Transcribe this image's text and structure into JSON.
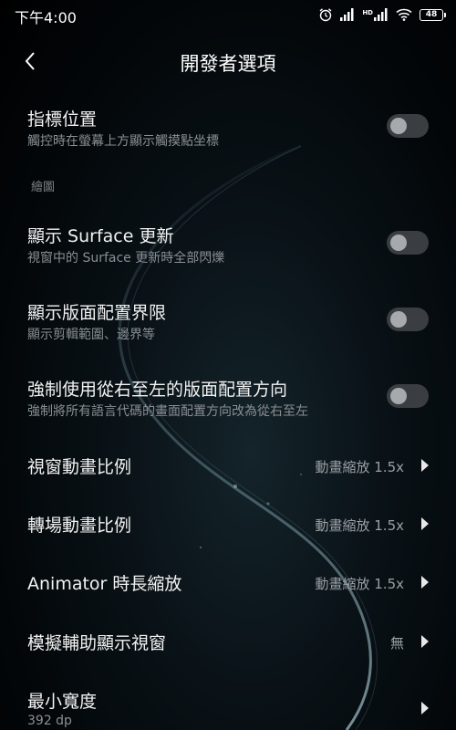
{
  "status_bar": {
    "time": "下午4:00",
    "hd_label": "HD",
    "battery_level": "48",
    "icons": [
      "alarm-icon",
      "signal-icon",
      "hd-signal-icon",
      "wifi-icon",
      "battery-icon"
    ]
  },
  "header": {
    "title": "開發者選項",
    "back_icon": "chevron-left-icon"
  },
  "settings": {
    "pointer_location": {
      "title": "指標位置",
      "subtitle": "觸控時在螢幕上方顯示觸摸點坐標",
      "enabled": false
    },
    "drawing_section": {
      "label": "繪圖"
    },
    "show_surface_updates": {
      "title": "顯示 Surface 更新",
      "subtitle": "視窗中的 Surface 更新時全部閃爍",
      "enabled": false
    },
    "show_layout_bounds": {
      "title": "顯示版面配置界限",
      "subtitle": "顯示剪輯範圍、邊界等",
      "enabled": false
    },
    "force_rtl": {
      "title": "強制使用從右至左的版面配置方向",
      "subtitle": "強制將所有語言代碼的畫面配置方向改為從右至左",
      "enabled": false
    },
    "window_animation_scale": {
      "title": "視窗動畫比例",
      "value": "動畫縮放 1.5x"
    },
    "transition_animation_scale": {
      "title": "轉場動畫比例",
      "value": "動畫縮放 1.5x"
    },
    "animator_duration_scale": {
      "title": "Animator 時長縮放",
      "value": "動畫縮放 1.5x"
    },
    "simulate_secondary_displays": {
      "title": "模擬輔助顯示視窗",
      "value": "無"
    },
    "smallest_width": {
      "title": "最小寬度",
      "subtitle": "392 dp"
    }
  },
  "colors": {
    "background": "#000000",
    "toggle_off_track": "#3a3d41",
    "toggle_off_knob": "#a6aaad",
    "subtitle": "#8a8f93"
  }
}
